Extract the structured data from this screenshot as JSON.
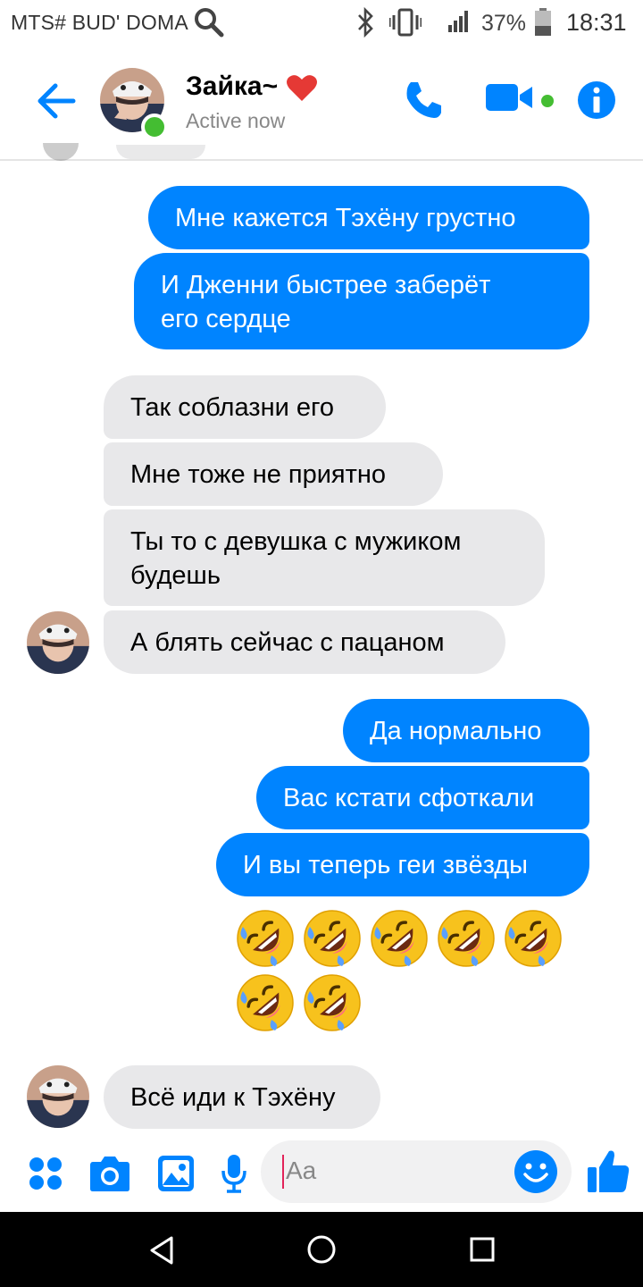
{
  "status_bar": {
    "carrier": "MTS# BUD' DOMA",
    "battery": "37%",
    "time": "18:31"
  },
  "header": {
    "contact_name": "Зайка~",
    "status": "Active now"
  },
  "messages": [
    {
      "side": "out",
      "text": "Мне кажется Тэхёну грустно"
    },
    {
      "side": "out",
      "text": "И Дженни быстрее заберёт\nего сердце"
    },
    {
      "side": "in",
      "text": "Так соблазни его"
    },
    {
      "side": "in",
      "text": "Мне тоже не приятно"
    },
    {
      "side": "in",
      "text": "Ты то с девушка с мужиком\nбудешь"
    },
    {
      "side": "in",
      "text": "А блять сейчас с пацаном"
    },
    {
      "side": "out",
      "text": "Да нормально"
    },
    {
      "side": "out",
      "text": "Вас кстати сфоткали"
    },
    {
      "side": "out",
      "text": "И вы теперь геи звёзды"
    },
    {
      "side": "in",
      "text": "Всё иди к Тэхёну"
    }
  ],
  "emoji_message": {
    "emoji": "rolling-on-floor-laughing",
    "count": 7
  },
  "composer": {
    "placeholder": "Aa"
  },
  "colors": {
    "accent": "#0084ff",
    "incoming_bubble": "#e8e8ea",
    "online": "#44bd32"
  }
}
